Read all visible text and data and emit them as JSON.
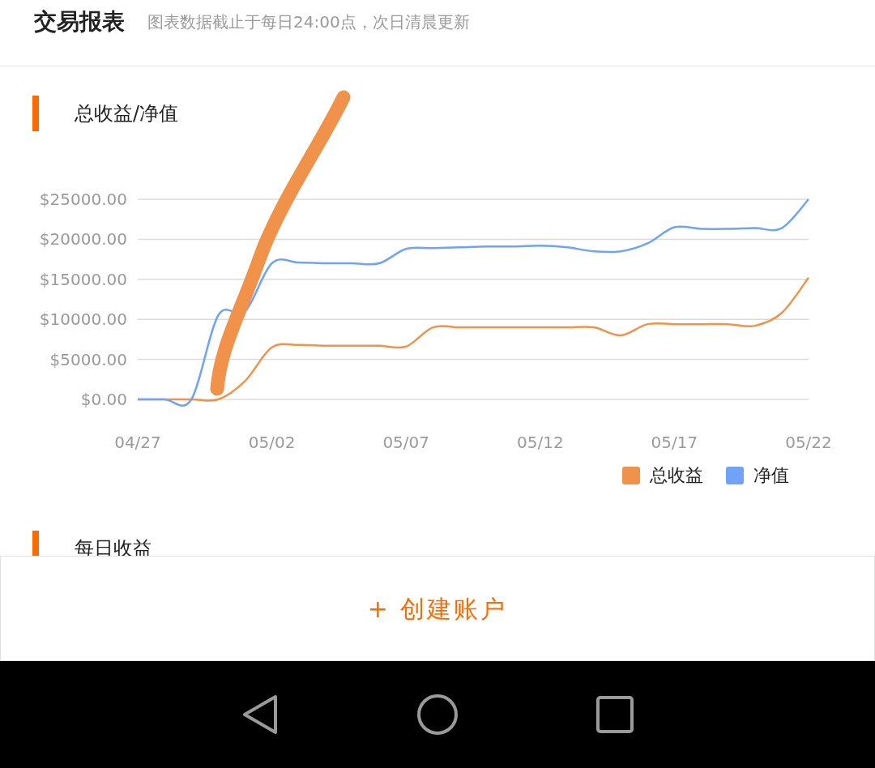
{
  "header": {
    "title": "交易报表",
    "note": "图表数据截止于每日24:00点，次日清晨更新"
  },
  "sections": [
    {
      "title": "总收益/净值",
      "chart_data": {
        "type": "line",
        "categories": [
          "04/27",
          null,
          null,
          null,
          null,
          "05/02",
          null,
          null,
          null,
          null,
          "05/07",
          null,
          null,
          null,
          null,
          "05/12",
          null,
          null,
          null,
          null,
          "05/17",
          null,
          null,
          null,
          null,
          "05/22"
        ],
        "ylim": [
          0,
          25000
        ],
        "grid": true,
        "legend": true,
        "series": [
          {
            "name": "总收益",
            "color": "#f0924a",
            "values": [
              0,
              0,
              0,
              0,
              2300,
              6500,
              6800,
              6700,
              6700,
              6700,
              6600,
              9000,
              9000,
              9000,
              9000,
              9000,
              9000,
              9000,
              8000,
              9400,
              9400,
              9400,
              9400,
              9200,
              10800,
              15200
            ]
          },
          {
            "name": "净值",
            "color": "#6ea3f7",
            "values": [
              0,
              0,
              0,
              10500,
              11000,
              17000,
              17100,
              17000,
              17000,
              17000,
              18800,
              18900,
              19000,
              19100,
              19100,
              19200,
              19000,
              18500,
              18500,
              19500,
              21500,
              21300,
              21300,
              21400,
              21400,
              25000
            ]
          }
        ],
        "yticks": [
          {
            "value": 0,
            "label": "$0.00"
          },
          {
            "value": 5000,
            "label": "$5000.00"
          },
          {
            "value": 10000,
            "label": "$10000.00"
          },
          {
            "value": 15000,
            "label": "$15000.00"
          },
          {
            "value": 20000,
            "label": "$20000.00"
          },
          {
            "value": 25000,
            "label": "$25000.00"
          }
        ]
      }
    },
    {
      "title": "每日收益"
    }
  ],
  "create_button": {
    "label": "+ 创建账户"
  }
}
